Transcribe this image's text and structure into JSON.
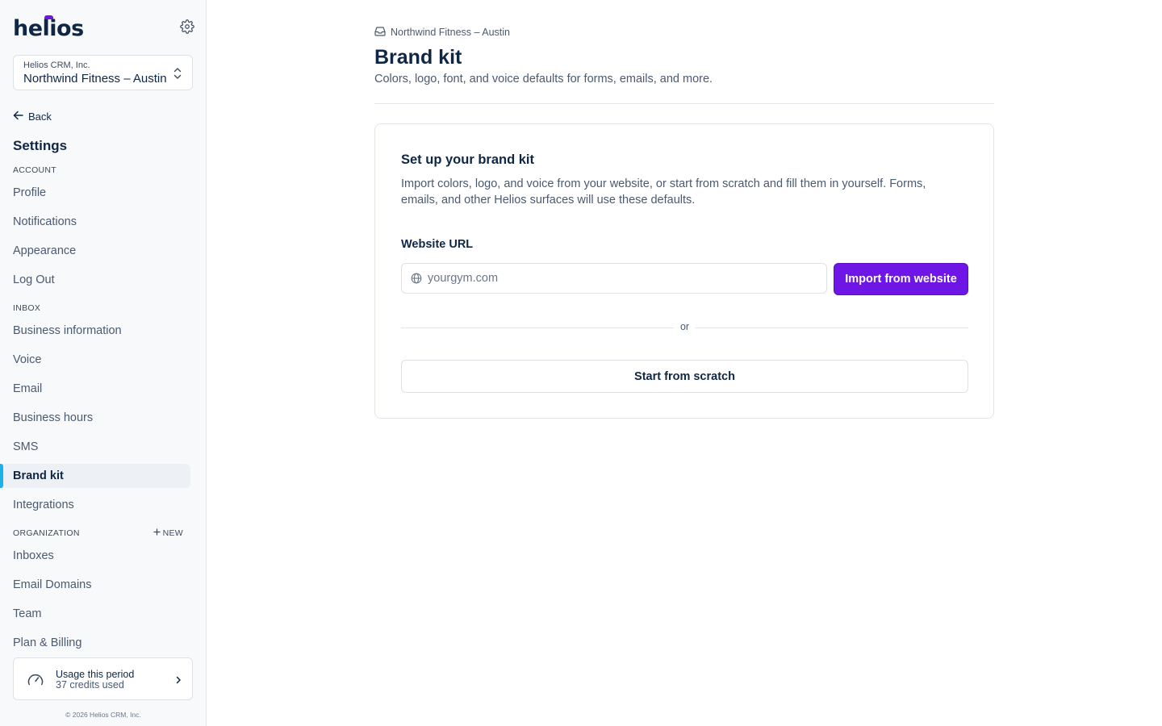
{
  "brand": {
    "logo_text": "helios",
    "accent_color": "#6d16e6"
  },
  "org_switcher": {
    "parent": "Helios CRM, Inc.",
    "name": "Northwind Fitness – Austin"
  },
  "sidebar": {
    "back_label": "Back",
    "title": "Settings",
    "sections": {
      "account": "ACCOUNT",
      "inbox": "INBOX",
      "organization": "ORGANIZATION",
      "new_label": "NEW"
    },
    "account_items": [
      "Profile",
      "Notifications",
      "Appearance",
      "Log Out"
    ],
    "inbox_items": [
      "Business information",
      "Voice",
      "Email",
      "Business hours",
      "SMS",
      "Brand kit",
      "Integrations"
    ],
    "organization_items": [
      "Inboxes",
      "Email Domains",
      "Team",
      "Plan & Billing"
    ],
    "active_item": "Brand kit",
    "usage": {
      "title": "Usage this period",
      "subtitle": "37 credits used"
    },
    "copyright": "© 2026 Helios CRM, Inc."
  },
  "main": {
    "breadcrumb": "Northwind Fitness – Austin",
    "title": "Brand kit",
    "subtitle": "Colors, logo, font, and voice defaults for forms, emails, and more.",
    "card": {
      "title": "Set up your brand kit",
      "description": "Import colors, logo, and voice from your website, or start from scratch and fill them in yourself. Forms, emails, and other Helios surfaces will use these defaults.",
      "url_label": "Website URL",
      "url_placeholder": "yourgym.com",
      "url_value": "",
      "import_button": "Import from website",
      "or_text": "or",
      "scratch_button": "Start from scratch"
    }
  },
  "icons": [
    "gear-icon",
    "chevron-up-down-icon",
    "arrow-left-icon",
    "plus-icon",
    "gauge-icon",
    "chevron-right-icon",
    "inbox-icon",
    "globe-icon"
  ]
}
